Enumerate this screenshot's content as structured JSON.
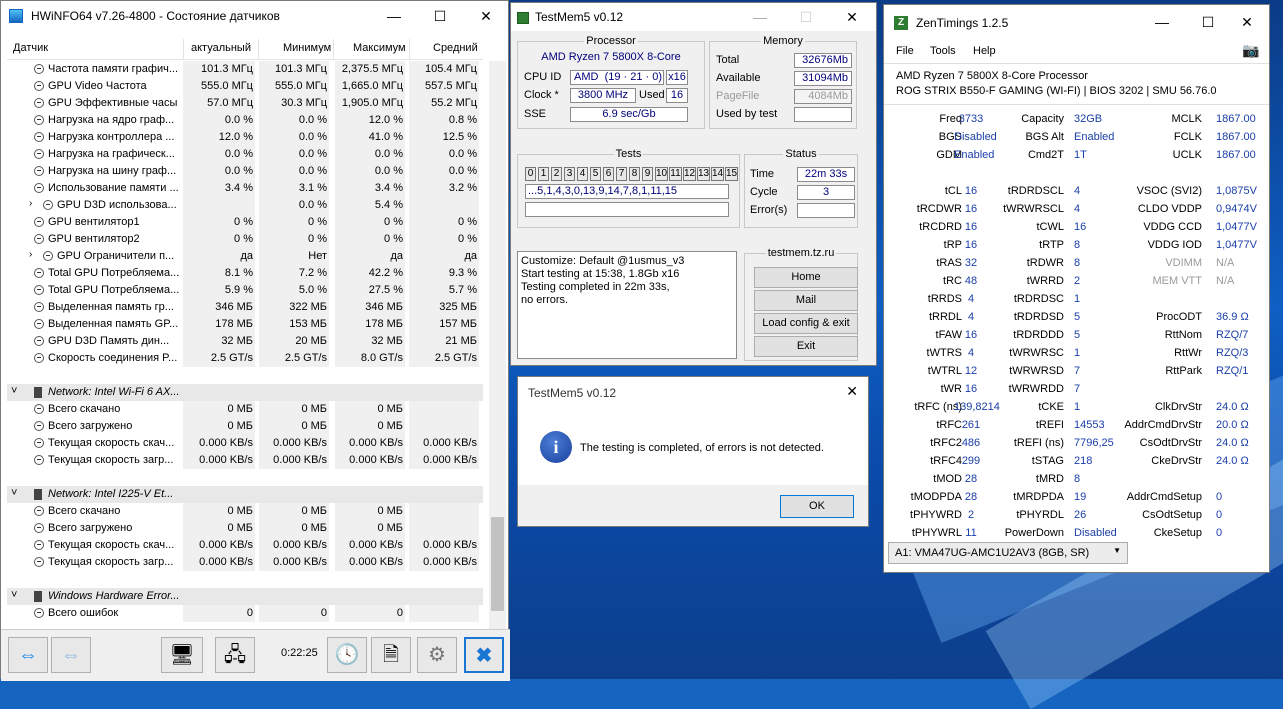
{
  "hwinfo": {
    "title": "HWiNFO64 v7.26-4800 - Состояние датчиков",
    "columns": [
      "Датчик",
      "актуальный",
      "Минимум",
      "Максимум",
      "Средний"
    ],
    "rows": [
      {
        "label": "Частота памяти графич...",
        "cur": "101.3 МГц",
        "min": "101.3 МГц",
        "max": "2,375.5 МГц",
        "avg": "105.4 МГц"
      },
      {
        "label": "GPU Video Частота",
        "cur": "555.0 МГц",
        "min": "555.0 МГц",
        "max": "1,665.0 МГц",
        "avg": "557.5 МГц"
      },
      {
        "label": "GPU Эффективные часы",
        "cur": "57.0 МГц",
        "min": "30.3 МГц",
        "max": "1,905.0 МГц",
        "avg": "55.2 МГц"
      },
      {
        "label": "Нагрузка на ядро граф...",
        "cur": "0.0 %",
        "min": "0.0 %",
        "max": "12.0 %",
        "avg": "0.8 %"
      },
      {
        "label": "Нагрузка контроллера ...",
        "cur": "12.0 %",
        "min": "0.0 %",
        "max": "41.0 %",
        "avg": "12.5 %"
      },
      {
        "label": "Нагрузка на графическ...",
        "cur": "0.0 %",
        "min": "0.0 %",
        "max": "0.0 %",
        "avg": "0.0 %"
      },
      {
        "label": "Нагрузка на шину граф...",
        "cur": "0.0 %",
        "min": "0.0 %",
        "max": "0.0 %",
        "avg": "0.0 %"
      },
      {
        "label": "Использование памяти ...",
        "cur": "3.4 %",
        "min": "3.1 %",
        "max": "3.4 %",
        "avg": "3.2 %"
      },
      {
        "label": "GPU D3D использова...",
        "cur": "",
        "min": "0.0 %",
        "max": "5.4 %",
        "avg": ""
      },
      {
        "label": "GPU вентилятор1",
        "cur": "0 %",
        "min": "0 %",
        "max": "0 %",
        "avg": "0 %"
      },
      {
        "label": "GPU вентилятор2",
        "cur": "0 %",
        "min": "0 %",
        "max": "0 %",
        "avg": "0 %"
      },
      {
        "label": "GPU Ограничители п...",
        "cur": "да",
        "min": "Нет",
        "max": "да",
        "avg": "да"
      },
      {
        "label": "Total GPU Потребляема...",
        "cur": "8.1 %",
        "min": "7.2 %",
        "max": "42.2 %",
        "avg": "9.3 %"
      },
      {
        "label": "Total GPU Потребляема...",
        "cur": "5.9 %",
        "min": "5.0 %",
        "max": "27.5 %",
        "avg": "5.7 %"
      },
      {
        "label": "Выделенная память гр...",
        "cur": "346 МБ",
        "min": "322 МБ",
        "max": "346 МБ",
        "avg": "325 МБ"
      },
      {
        "label": "Выделенная память GP...",
        "cur": "178 МБ",
        "min": "153 МБ",
        "max": "178 МБ",
        "avg": "157 МБ"
      },
      {
        "label": "GPU D3D Память дин...",
        "cur": "32 МБ",
        "min": "20 МБ",
        "max": "32 МБ",
        "avg": "21 МБ"
      },
      {
        "label": "Скорость соединения P...",
        "cur": "2.5 GT/s",
        "min": "2.5 GT/s",
        "max": "8.0 GT/s",
        "avg": "2.5 GT/s"
      }
    ],
    "group_wifi": "Network: Intel Wi-Fi 6 AX...",
    "wifi_rows": [
      {
        "label": "Всего скачано",
        "cur": "0 МБ",
        "min": "0 МБ",
        "max": "0 МБ",
        "avg": ""
      },
      {
        "label": "Всего загружено",
        "cur": "0 МБ",
        "min": "0 МБ",
        "max": "0 МБ",
        "avg": ""
      },
      {
        "label": "Текущая скорость скач...",
        "cur": "0.000 KB/s",
        "min": "0.000 KB/s",
        "max": "0.000 KB/s",
        "avg": "0.000 KB/s"
      },
      {
        "label": "Текущая скорость загр...",
        "cur": "0.000 KB/s",
        "min": "0.000 KB/s",
        "max": "0.000 KB/s",
        "avg": "0.000 KB/s"
      }
    ],
    "group_eth": "Network: Intel I225-V Et...",
    "eth_rows": [
      {
        "label": "Всего скачано",
        "cur": "0 МБ",
        "min": "0 МБ",
        "max": "0 МБ",
        "avg": ""
      },
      {
        "label": "Всего загружено",
        "cur": "0 МБ",
        "min": "0 МБ",
        "max": "0 МБ",
        "avg": ""
      },
      {
        "label": "Текущая скорость скач...",
        "cur": "0.000 KB/s",
        "min": "0.000 KB/s",
        "max": "0.000 KB/s",
        "avg": "0.000 KB/s"
      },
      {
        "label": "Текущая скорость загр...",
        "cur": "0.000 KB/s",
        "min": "0.000 KB/s",
        "max": "0.000 KB/s",
        "avg": "0.000 KB/s"
      }
    ],
    "group_whea": "Windows Hardware Error...",
    "whea_rows": [
      {
        "label": "Всего ошибок",
        "cur": "0",
        "min": "0",
        "max": "0",
        "avg": ""
      }
    ],
    "timer": "0:22:25"
  },
  "testmem": {
    "title": "TestMem5 v0.12",
    "processor_label": "Processor",
    "processor_name": "AMD Ryzen 7 5800X 8-Core",
    "cpuid_label": "CPU ID",
    "cpuid_vendor": "AMD",
    "cpuid_sig": "(19 · 21 · 0)",
    "cpuid_threads": "x16",
    "clock_label": "Clock *",
    "clock_value": "3800 MHz",
    "used_label": "Used",
    "used_value": "16",
    "sse_label": "SSE",
    "sse_value": "6.9 sec/Gb",
    "memory_label": "Memory",
    "total_label": "Total",
    "total_value": "32676Mb",
    "available_label": "Available",
    "available_value": "31094Mb",
    "pagefile_label": "PageFile",
    "pagefile_value": "4084Mb",
    "usedbytest_label": "Used by test",
    "tests_label": "Tests",
    "test_numbers": [
      "0",
      "1",
      "2",
      "3",
      "4",
      "5",
      "6",
      "7",
      "8",
      "9",
      "10",
      "11",
      "12",
      "13",
      "14",
      "15"
    ],
    "test_sequence": "...5,1,4,3,0,13,9,14,7,8,1,11,15",
    "status_label": "Status",
    "time_label": "Time",
    "time_value": "22m 33s",
    "cycle_label": "Cycle",
    "cycle_value": "3",
    "errors_label": "Error(s)",
    "log_lines": [
      "Customize: Default @1usmus_v3",
      "Start testing at 15:38, 1.8Gb x16",
      "Testing completed in 22m 33s,",
      "no errors."
    ],
    "site": "testmem.tz.ru",
    "buttons": [
      "Home",
      "Mail",
      "Load config & exit",
      "Exit"
    ]
  },
  "dialog": {
    "title": "TestMem5 v0.12",
    "message": "The testing is completed, of errors is not detected.",
    "ok": "OK"
  },
  "zentimings": {
    "title": "ZenTimings 1.2.5",
    "menu": [
      "File",
      "Tools",
      "Help"
    ],
    "cpu": "AMD Ryzen 7 5800X 8-Core Processor",
    "board": "ROG STRIX B550-F GAMING (WI-FI) | BIOS 3202 | SMU 56.76.0",
    "col1": [
      [
        "Freq",
        "3733"
      ],
      [
        "BGS",
        "Disabled"
      ],
      [
        "GDM",
        "Enabled"
      ],
      [
        "",
        ""
      ],
      [
        "tCL",
        "16"
      ],
      [
        "tRCDWR",
        "16"
      ],
      [
        "tRCDRD",
        "16"
      ],
      [
        "tRP",
        "16"
      ],
      [
        "tRAS",
        "32"
      ],
      [
        "tRC",
        "48"
      ],
      [
        "tRRDS",
        "4"
      ],
      [
        "tRRDL",
        "4"
      ],
      [
        "tFAW",
        "16"
      ],
      [
        "tWTRS",
        "4"
      ],
      [
        "tWTRL",
        "12"
      ],
      [
        "tWR",
        "16"
      ],
      [
        "tRFC (ns)",
        "139,8214"
      ],
      [
        "tRFC",
        "261"
      ],
      [
        "tRFC2",
        "486"
      ],
      [
        "tRFC4",
        "299"
      ],
      [
        "tMOD",
        "28"
      ],
      [
        "tMODPDA",
        "28"
      ],
      [
        "tPHYWRD",
        "2"
      ],
      [
        "tPHYWRL",
        "11"
      ]
    ],
    "col2": [
      [
        "Capacity",
        "32GB"
      ],
      [
        "BGS Alt",
        "Enabled"
      ],
      [
        "Cmd2T",
        "1T"
      ],
      [
        "",
        ""
      ],
      [
        "tRDRDSCL",
        "4"
      ],
      [
        "tWRWRSCL",
        "4"
      ],
      [
        "tCWL",
        "16"
      ],
      [
        "tRTP",
        "8"
      ],
      [
        "tRDWR",
        "8"
      ],
      [
        "tWRRD",
        "2"
      ],
      [
        "tRDRDSC",
        "1"
      ],
      [
        "tRDRDSD",
        "5"
      ],
      [
        "tRDRDDD",
        "5"
      ],
      [
        "tWRWRSC",
        "1"
      ],
      [
        "tWRWRSD",
        "7"
      ],
      [
        "tWRWRDD",
        "7"
      ],
      [
        "tCKE",
        "1"
      ],
      [
        "tREFI",
        "14553"
      ],
      [
        "tREFI (ns)",
        "7796,25"
      ],
      [
        "tSTAG",
        "218"
      ],
      [
        "tMRD",
        "8"
      ],
      [
        "tMRDPDA",
        "19"
      ],
      [
        "tPHYRDL",
        "26"
      ],
      [
        "PowerDown",
        "Disabled"
      ]
    ],
    "col3": [
      [
        "MCLK",
        "1867.00"
      ],
      [
        "FCLK",
        "1867.00"
      ],
      [
        "UCLK",
        "1867.00"
      ],
      [
        "",
        ""
      ],
      [
        "VSOC (SVI2)",
        "1,0875V"
      ],
      [
        "CLDO VDDP",
        "0,9474V"
      ],
      [
        "VDDG CCD",
        "1,0477V"
      ],
      [
        "VDDG IOD",
        "1,0477V"
      ],
      [
        "VDIMM",
        "N/A"
      ],
      [
        "MEM VTT",
        "N/A"
      ],
      [
        "",
        ""
      ],
      [
        "ProcODT",
        "36.9 Ω"
      ],
      [
        "RttNom",
        "RZQ/7"
      ],
      [
        "RttWr",
        "RZQ/3"
      ],
      [
        "RttPark",
        "RZQ/1"
      ],
      [
        "",
        ""
      ],
      [
        "ClkDrvStr",
        "24.0 Ω"
      ],
      [
        "AddrCmdDrvStr",
        "20.0 Ω"
      ],
      [
        "CsOdtDrvStr",
        "24.0 Ω"
      ],
      [
        "CkeDrvStr",
        "24.0 Ω"
      ],
      [
        "",
        ""
      ],
      [
        "AddrCmdSetup",
        "0"
      ],
      [
        "CsOdtSetup",
        "0"
      ],
      [
        "CkeSetup",
        "0"
      ]
    ],
    "dimm_select": "A1: VMA47UG-AMC1U2AV3 (8GB, SR)"
  }
}
